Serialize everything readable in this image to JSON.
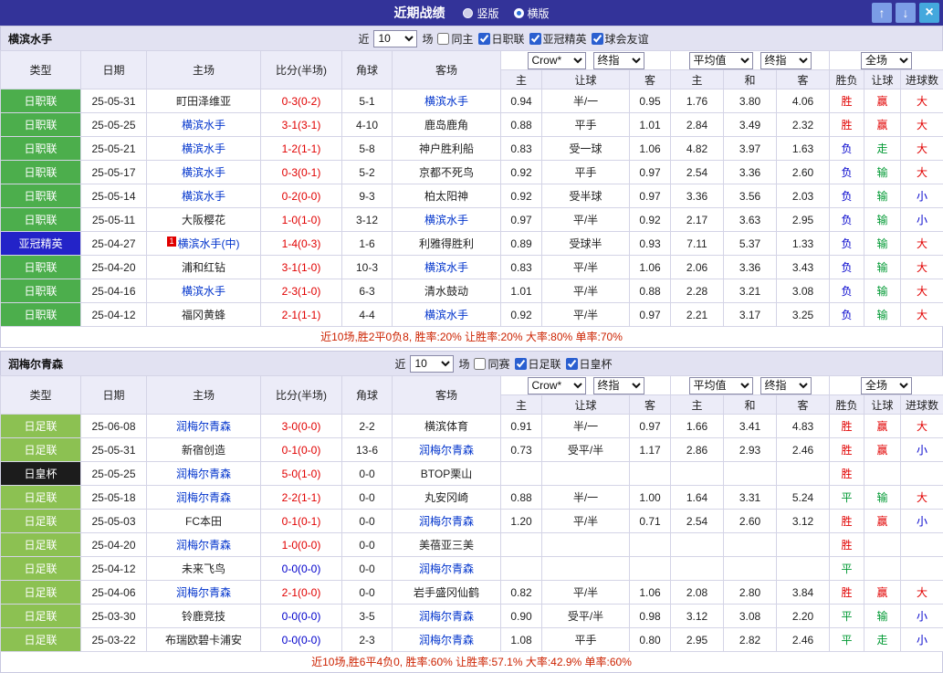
{
  "topbar": {
    "title": "近期战绩",
    "radios": [
      {
        "label": "竖版",
        "selected": false
      },
      {
        "label": "横版",
        "selected": true
      }
    ],
    "buttons": {
      "up": "↑",
      "down": "↓",
      "close": "×"
    }
  },
  "sections": [
    {
      "team": "横滨水手",
      "filter": {
        "near": "近",
        "games": "10",
        "unit": "场",
        "checkboxes": [
          {
            "label": "同主",
            "checked": false
          },
          {
            "label": "日职联",
            "checked": true
          },
          {
            "label": "亚冠精英",
            "checked": true
          },
          {
            "label": "球会友谊",
            "checked": true
          }
        ]
      },
      "selects": {
        "s1": "Crow*",
        "s2": "终指",
        "s3": "平均值",
        "s4": "终指",
        "s5": "全场"
      },
      "header": {
        "type": "类型",
        "date": "日期",
        "home": "主场",
        "score": "比分(半场)",
        "corner": "角球",
        "away": "客场",
        "sub": [
          "主",
          "让球",
          "客",
          "主",
          "和",
          "客",
          "胜负",
          "让球",
          "进球数"
        ]
      },
      "rows": [
        {
          "type": "日职联",
          "type_class": "lg-jleague",
          "date": "25-05-31",
          "home": "町田泽维亚",
          "home_focus": false,
          "home_marker": "",
          "score": "0-3(0-2)",
          "score_class": "red",
          "corner": "5-1",
          "away": "横滨水手",
          "away_focus": true,
          "odds": [
            "0.94",
            "半/一",
            "0.95",
            "1.76",
            "3.80",
            "4.06"
          ],
          "results": [
            [
              "胜",
              "red"
            ],
            [
              "赢",
              "red"
            ],
            [
              "大",
              "red"
            ]
          ]
        },
        {
          "type": "日职联",
          "type_class": "lg-jleague",
          "date": "25-05-25",
          "home": "横滨水手",
          "home_focus": true,
          "home_marker": "",
          "score": "3-1(3-1)",
          "score_class": "red",
          "corner": "4-10",
          "away": "鹿岛鹿角",
          "away_focus": false,
          "odds": [
            "0.88",
            "平手",
            "1.01",
            "2.84",
            "3.49",
            "2.32"
          ],
          "results": [
            [
              "胜",
              "red"
            ],
            [
              "赢",
              "red"
            ],
            [
              "大",
              "red"
            ]
          ]
        },
        {
          "type": "日职联",
          "type_class": "lg-jleague",
          "date": "25-05-21",
          "home": "横滨水手",
          "home_focus": true,
          "home_marker": "",
          "score": "1-2(1-1)",
          "score_class": "red",
          "corner": "5-8",
          "away": "神户胜利船",
          "away_focus": false,
          "odds": [
            "0.83",
            "受一球",
            "1.06",
            "4.82",
            "3.97",
            "1.63"
          ],
          "results": [
            [
              "负",
              "blue"
            ],
            [
              "走",
              "green"
            ],
            [
              "大",
              "red"
            ]
          ]
        },
        {
          "type": "日职联",
          "type_class": "lg-jleague",
          "date": "25-05-17",
          "home": "横滨水手",
          "home_focus": true,
          "home_marker": "",
          "score": "0-3(0-1)",
          "score_class": "red",
          "corner": "5-2",
          "away": "京都不死鸟",
          "away_focus": false,
          "odds": [
            "0.92",
            "平手",
            "0.97",
            "2.54",
            "3.36",
            "2.60"
          ],
          "results": [
            [
              "负",
              "blue"
            ],
            [
              "输",
              "green"
            ],
            [
              "大",
              "red"
            ]
          ]
        },
        {
          "type": "日职联",
          "type_class": "lg-jleague",
          "date": "25-05-14",
          "home": "横滨水手",
          "home_focus": true,
          "home_marker": "",
          "score": "0-2(0-0)",
          "score_class": "red",
          "corner": "9-3",
          "away": "柏太阳神",
          "away_focus": false,
          "odds": [
            "0.92",
            "受半球",
            "0.97",
            "3.36",
            "3.56",
            "2.03"
          ],
          "results": [
            [
              "负",
              "blue"
            ],
            [
              "输",
              "green"
            ],
            [
              "小",
              "blue"
            ]
          ]
        },
        {
          "type": "日职联",
          "type_class": "lg-jleague",
          "date": "25-05-11",
          "home": "大阪樱花",
          "home_focus": false,
          "home_marker": "",
          "score": "1-0(1-0)",
          "score_class": "red",
          "corner": "3-12",
          "away": "横滨水手",
          "away_focus": true,
          "odds": [
            "0.97",
            "平/半",
            "0.92",
            "2.17",
            "3.63",
            "2.95"
          ],
          "results": [
            [
              "负",
              "blue"
            ],
            [
              "输",
              "green"
            ],
            [
              "小",
              "blue"
            ]
          ]
        },
        {
          "type": "亚冠精英",
          "type_class": "lg-acl",
          "date": "25-04-27",
          "home": "横滨水手(中)",
          "home_focus": true,
          "home_marker": "1",
          "score": "1-4(0-3)",
          "score_class": "red",
          "corner": "1-6",
          "away": "利雅得胜利",
          "away_focus": false,
          "odds": [
            "0.89",
            "受球半",
            "0.93",
            "7.11",
            "5.37",
            "1.33"
          ],
          "results": [
            [
              "负",
              "blue"
            ],
            [
              "输",
              "green"
            ],
            [
              "大",
              "red"
            ]
          ]
        },
        {
          "type": "日职联",
          "type_class": "lg-jleague",
          "date": "25-04-20",
          "home": "浦和红钻",
          "home_focus": false,
          "home_marker": "",
          "score": "3-1(1-0)",
          "score_class": "red",
          "corner": "10-3",
          "away": "横滨水手",
          "away_focus": true,
          "odds": [
            "0.83",
            "平/半",
            "1.06",
            "2.06",
            "3.36",
            "3.43"
          ],
          "results": [
            [
              "负",
              "blue"
            ],
            [
              "输",
              "green"
            ],
            [
              "大",
              "red"
            ]
          ]
        },
        {
          "type": "日职联",
          "type_class": "lg-jleague",
          "date": "25-04-16",
          "home": "横滨水手",
          "home_focus": true,
          "home_marker": "",
          "score": "2-3(1-0)",
          "score_class": "red",
          "corner": "6-3",
          "away": "清水鼓动",
          "away_focus": false,
          "odds": [
            "1.01",
            "平/半",
            "0.88",
            "2.28",
            "3.21",
            "3.08"
          ],
          "results": [
            [
              "负",
              "blue"
            ],
            [
              "输",
              "green"
            ],
            [
              "大",
              "red"
            ]
          ]
        },
        {
          "type": "日职联",
          "type_class": "lg-jleague",
          "date": "25-04-12",
          "home": "福冈黄蜂",
          "home_focus": false,
          "home_marker": "",
          "score": "2-1(1-1)",
          "score_class": "red",
          "corner": "4-4",
          "away": "横滨水手",
          "away_focus": true,
          "odds": [
            "0.92",
            "平/半",
            "0.97",
            "2.21",
            "3.17",
            "3.25"
          ],
          "results": [
            [
              "负",
              "blue"
            ],
            [
              "输",
              "green"
            ],
            [
              "大",
              "red"
            ]
          ]
        }
      ],
      "summary": "近10场,胜2平0负8, 胜率:20% 让胜率:20% 大率:80% 单率:70%"
    },
    {
      "team": "润梅尔青森",
      "filter": {
        "near": "近",
        "games": "10",
        "unit": "场",
        "checkboxes": [
          {
            "label": "同赛",
            "checked": false
          },
          {
            "label": "日足联",
            "checked": true
          },
          {
            "label": "日皇杯",
            "checked": true
          }
        ]
      },
      "selects": {
        "s1": "Crow*",
        "s2": "终指",
        "s3": "平均值",
        "s4": "终指",
        "s5": "全场"
      },
      "header": {
        "type": "类型",
        "date": "日期",
        "home": "主场",
        "score": "比分(半场)",
        "corner": "角球",
        "away": "客场",
        "sub": [
          "主",
          "让球",
          "客",
          "主",
          "和",
          "客",
          "胜负",
          "让球",
          "进球数"
        ]
      },
      "rows": [
        {
          "type": "日足联",
          "type_class": "lg-jfl",
          "date": "25-06-08",
          "home": "润梅尔青森",
          "home_focus": true,
          "home_marker": "",
          "score": "3-0(0-0)",
          "score_class": "red",
          "corner": "2-2",
          "away": "横滨体育",
          "away_focus": false,
          "odds": [
            "0.91",
            "半/一",
            "0.97",
            "1.66",
            "3.41",
            "4.83"
          ],
          "results": [
            [
              "胜",
              "red"
            ],
            [
              "赢",
              "red"
            ],
            [
              "大",
              "red"
            ]
          ]
        },
        {
          "type": "日足联",
          "type_class": "lg-jfl",
          "date": "25-05-31",
          "home": "新宿创造",
          "home_focus": false,
          "home_marker": "",
          "score": "0-1(0-0)",
          "score_class": "red",
          "corner": "13-6",
          "away": "润梅尔青森",
          "away_focus": true,
          "odds": [
            "0.73",
            "受平/半",
            "1.17",
            "2.86",
            "2.93",
            "2.46"
          ],
          "results": [
            [
              "胜",
              "red"
            ],
            [
              "赢",
              "red"
            ],
            [
              "小",
              "blue"
            ]
          ]
        },
        {
          "type": "日皇杯",
          "type_class": "lg-cup",
          "date": "25-05-25",
          "home": "润梅尔青森",
          "home_focus": true,
          "home_marker": "",
          "score": "5-0(1-0)",
          "score_class": "red",
          "corner": "0-0",
          "away": "BTOP栗山",
          "away_focus": false,
          "odds": [
            "",
            "",
            "",
            "",
            "",
            ""
          ],
          "results": [
            [
              "胜",
              "red"
            ],
            [
              "",
              ""
            ],
            [
              "",
              ""
            ]
          ]
        },
        {
          "type": "日足联",
          "type_class": "lg-jfl",
          "date": "25-05-18",
          "home": "润梅尔青森",
          "home_focus": true,
          "home_marker": "",
          "score": "2-2(1-1)",
          "score_class": "red",
          "corner": "0-0",
          "away": "丸安冈崎",
          "away_focus": false,
          "odds": [
            "0.88",
            "半/一",
            "1.00",
            "1.64",
            "3.31",
            "5.24"
          ],
          "results": [
            [
              "平",
              "green"
            ],
            [
              "输",
              "green"
            ],
            [
              "大",
              "red"
            ]
          ]
        },
        {
          "type": "日足联",
          "type_class": "lg-jfl",
          "date": "25-05-03",
          "home": "FC本田",
          "home_focus": false,
          "home_marker": "",
          "score": "0-1(0-1)",
          "score_class": "red",
          "corner": "0-0",
          "away": "润梅尔青森",
          "away_focus": true,
          "odds": [
            "1.20",
            "平/半",
            "0.71",
            "2.54",
            "2.60",
            "3.12"
          ],
          "results": [
            [
              "胜",
              "red"
            ],
            [
              "赢",
              "red"
            ],
            [
              "小",
              "blue"
            ]
          ]
        },
        {
          "type": "日足联",
          "type_class": "lg-jfl",
          "date": "25-04-20",
          "home": "润梅尔青森",
          "home_focus": true,
          "home_marker": "",
          "score": "1-0(0-0)",
          "score_class": "red",
          "corner": "0-0",
          "away": "美蓓亚三美",
          "away_focus": false,
          "odds": [
            "",
            "",
            "",
            "",
            "",
            ""
          ],
          "results": [
            [
              "胜",
              "red"
            ],
            [
              "",
              ""
            ],
            [
              "",
              ""
            ]
          ]
        },
        {
          "type": "日足联",
          "type_class": "lg-jfl",
          "date": "25-04-12",
          "home": "未来飞鸟",
          "home_focus": false,
          "home_marker": "",
          "score": "0-0(0-0)",
          "score_class": "blue",
          "corner": "0-0",
          "away": "润梅尔青森",
          "away_focus": true,
          "odds": [
            "",
            "",
            "",
            "",
            "",
            ""
          ],
          "results": [
            [
              "平",
              "green"
            ],
            [
              "",
              ""
            ],
            [
              "",
              ""
            ]
          ]
        },
        {
          "type": "日足联",
          "type_class": "lg-jfl",
          "date": "25-04-06",
          "home": "润梅尔青森",
          "home_focus": true,
          "home_marker": "",
          "score": "2-1(0-0)",
          "score_class": "red",
          "corner": "0-0",
          "away": "岩手盛冈仙鹤",
          "away_focus": false,
          "odds": [
            "0.82",
            "平/半",
            "1.06",
            "2.08",
            "2.80",
            "3.84"
          ],
          "results": [
            [
              "胜",
              "red"
            ],
            [
              "赢",
              "red"
            ],
            [
              "大",
              "red"
            ]
          ]
        },
        {
          "type": "日足联",
          "type_class": "lg-jfl",
          "date": "25-03-30",
          "home": "铃鹿竞技",
          "home_focus": false,
          "home_marker": "",
          "score": "0-0(0-0)",
          "score_class": "blue",
          "corner": "3-5",
          "away": "润梅尔青森",
          "away_focus": true,
          "odds": [
            "0.90",
            "受平/半",
            "0.98",
            "3.12",
            "3.08",
            "2.20"
          ],
          "results": [
            [
              "平",
              "green"
            ],
            [
              "输",
              "green"
            ],
            [
              "小",
              "blue"
            ]
          ]
        },
        {
          "type": "日足联",
          "type_class": "lg-jfl",
          "date": "25-03-22",
          "home": "布瑞欧碧卡浦安",
          "home_focus": false,
          "home_marker": "",
          "score": "0-0(0-0)",
          "score_class": "blue",
          "corner": "2-3",
          "away": "润梅尔青森",
          "away_focus": true,
          "odds": [
            "1.08",
            "平手",
            "0.80",
            "2.95",
            "2.82",
            "2.46"
          ],
          "results": [
            [
              "平",
              "green"
            ],
            [
              "走",
              "green"
            ],
            [
              "小",
              "blue"
            ]
          ]
        }
      ],
      "summary": "近10场,胜6平4负0, 胜率:60% 让胜率:57.1% 大率:42.9% 单率:60%"
    }
  ]
}
